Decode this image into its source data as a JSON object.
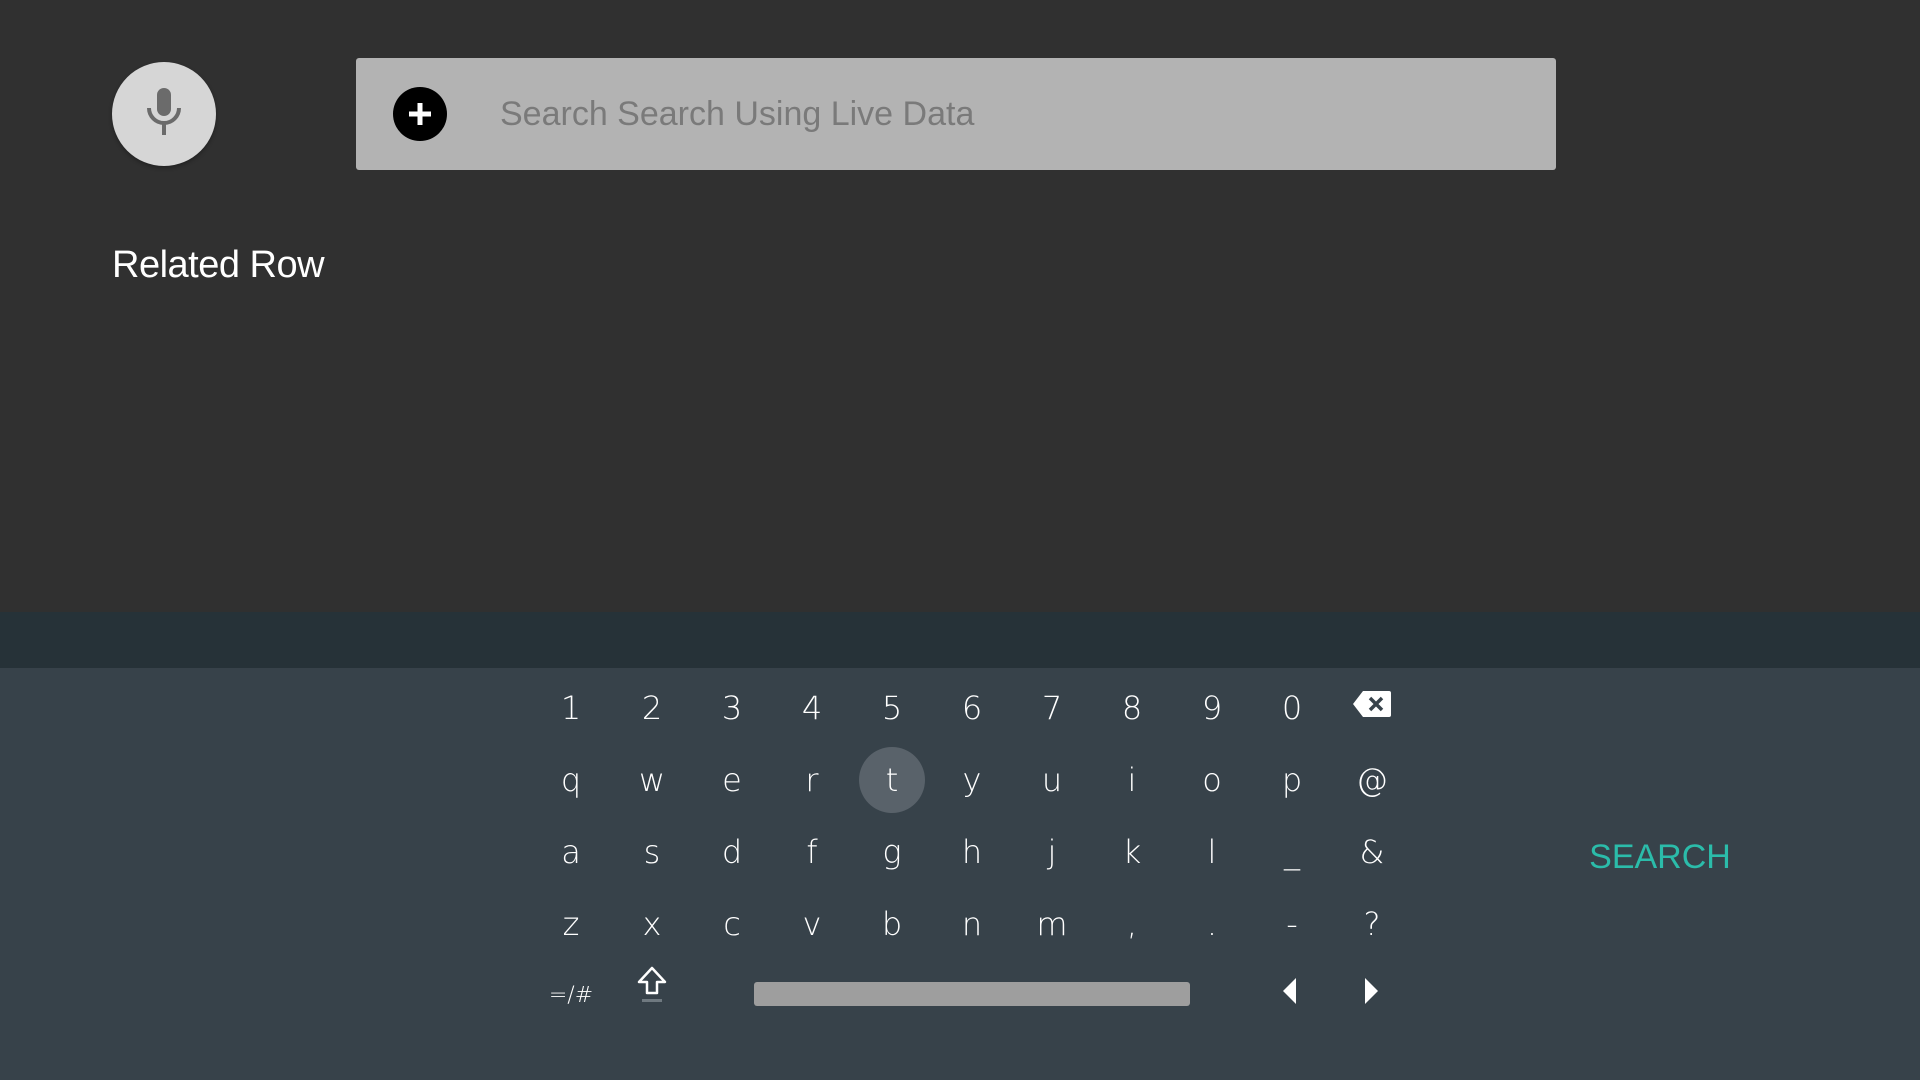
{
  "search": {
    "placeholder": "Search Search Using Live Data",
    "value": ""
  },
  "row": {
    "header": "Related Row"
  },
  "keyboard": {
    "digits": [
      "1",
      "2",
      "3",
      "4",
      "5",
      "6",
      "7",
      "8",
      "9",
      "0"
    ],
    "row1": [
      "q",
      "w",
      "e",
      "r",
      "t",
      "y",
      "u",
      "i",
      "o",
      "p",
      "@"
    ],
    "row2": [
      "a",
      "s",
      "d",
      "f",
      "g",
      "h",
      "j",
      "k",
      "l",
      "_",
      "&"
    ],
    "row3": [
      "z",
      "x",
      "c",
      "v",
      "b",
      "n",
      "m",
      ",",
      ".",
      "-",
      "?"
    ],
    "symbols_label": "=/#",
    "focused_key": "t",
    "action_label": "SEARCH"
  },
  "icons": {
    "mic": "mic-icon",
    "search_badge": "plus-icon",
    "backspace": "backspace-icon",
    "shift": "shift-icon",
    "left": "arrow-left-icon",
    "right": "arrow-right-icon"
  },
  "colors": {
    "background": "#303030",
    "search_box": "#b3b3b3",
    "keyboard_band": "#263238",
    "keyboard": "#37424a",
    "accent": "#2bbcaa",
    "focused_key": "#59626a"
  }
}
